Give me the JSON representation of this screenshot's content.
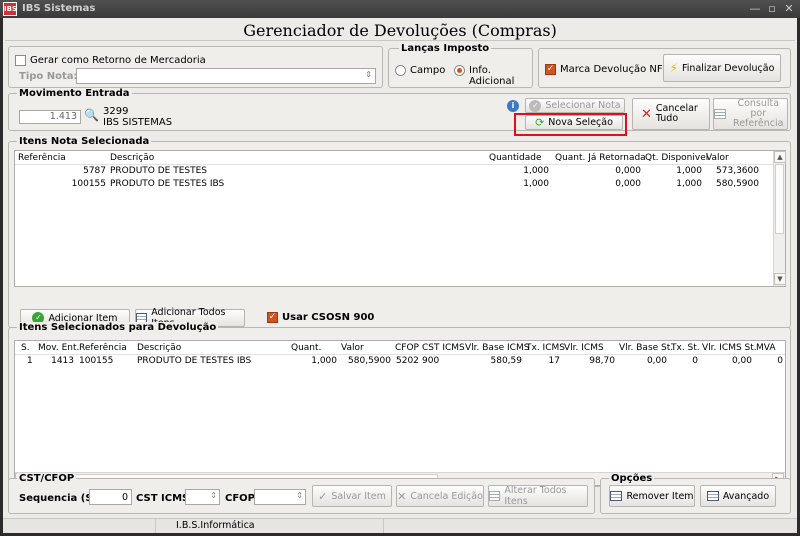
{
  "window": {
    "title": "IBS Sistemas",
    "app_icon": "IBS"
  },
  "page": {
    "title": "Gerenciador de Devoluções (Compras)"
  },
  "top": {
    "retorno_checkbox_label": "Gerar como Retorno de Mercadoria",
    "tipo_nota_label": "Tipo Nota:",
    "tipo_nota_value": "",
    "lancas_imposto": {
      "title": "Lanças Imposto",
      "option_campo": "Campo",
      "option_info": "Info. Adicional"
    },
    "marca_checkbox_label": "Marca Devolução NF-e",
    "finalizar_button": "Finalizar Devolução"
  },
  "movimento": {
    "title": "Movimento Entrada",
    "value": "1.413",
    "code": "3299",
    "company": "IBS SISTEMAS",
    "selecionar_nota": "Selecionar Nota",
    "nova_selecao": "Nova Seleção",
    "cancelar_line1": "Cancelar",
    "cancelar_line2": "Tudo",
    "consulta_line1": "Consulta por",
    "consulta_line2": "Referência"
  },
  "itens_nota": {
    "title": "Itens Nota Selecionada",
    "headers": [
      "Referência",
      "Descrição",
      "Quantidade",
      "Quant. Já Retornada",
      "Qt. Disponivel",
      "Valor"
    ],
    "rows": [
      [
        "5787",
        "PRODUTO DE TESTES",
        "1,000",
        "0,000",
        "1,000",
        "573,3600"
      ],
      [
        "100155",
        "PRODUTO DE TESTES IBS",
        "1,000",
        "0,000",
        "1,000",
        "580,5900"
      ]
    ],
    "adicionar_item": "Adicionar Item",
    "adicionar_todos": "Adicionar Todos Itens",
    "usar_csosn": "Usar CSOSN 900"
  },
  "itens_devolucao": {
    "title": "Itens Selecionados para Devolução",
    "headers": [
      "S.",
      "Mov. Ent.",
      "Referência",
      "Descrição",
      "Quant.",
      "Valor",
      "CFOP",
      "CST ICMS",
      "Vlr. Base ICMS",
      "Tx. ICMS",
      "Vlr. ICMS",
      "Vlr. Base St.",
      "Tx. St.",
      "Vlr. ICMS St.",
      "MVA"
    ],
    "rows": [
      [
        "1",
        "1413",
        "100155",
        "PRODUTO DE TESTES IBS",
        "1,000",
        "580,5900",
        "5202",
        "900",
        "580,59",
        "17",
        "98,70",
        "0,00",
        "0",
        "0,00",
        "0"
      ]
    ]
  },
  "cst_cfop": {
    "title": "CST/CFOP",
    "sequencia_label": "Sequencia (S.)",
    "sequencia_value": "0",
    "cst_icms_label": "CST ICMS",
    "cfop_label": "CFOP",
    "salvar_item": "Salvar Item",
    "cancela_edicao": "Cancela Edição",
    "alterar_todos": "Alterar Todos Itens"
  },
  "opcoes": {
    "title": "Opções",
    "remover_item": "Remover Item",
    "avancado": "Avançado"
  },
  "status": {
    "text": "I.B.S.Informática"
  },
  "colors": {
    "accent": "#d1531f",
    "highlight": "#e0101a",
    "title_bar": "#3a3a3a"
  }
}
